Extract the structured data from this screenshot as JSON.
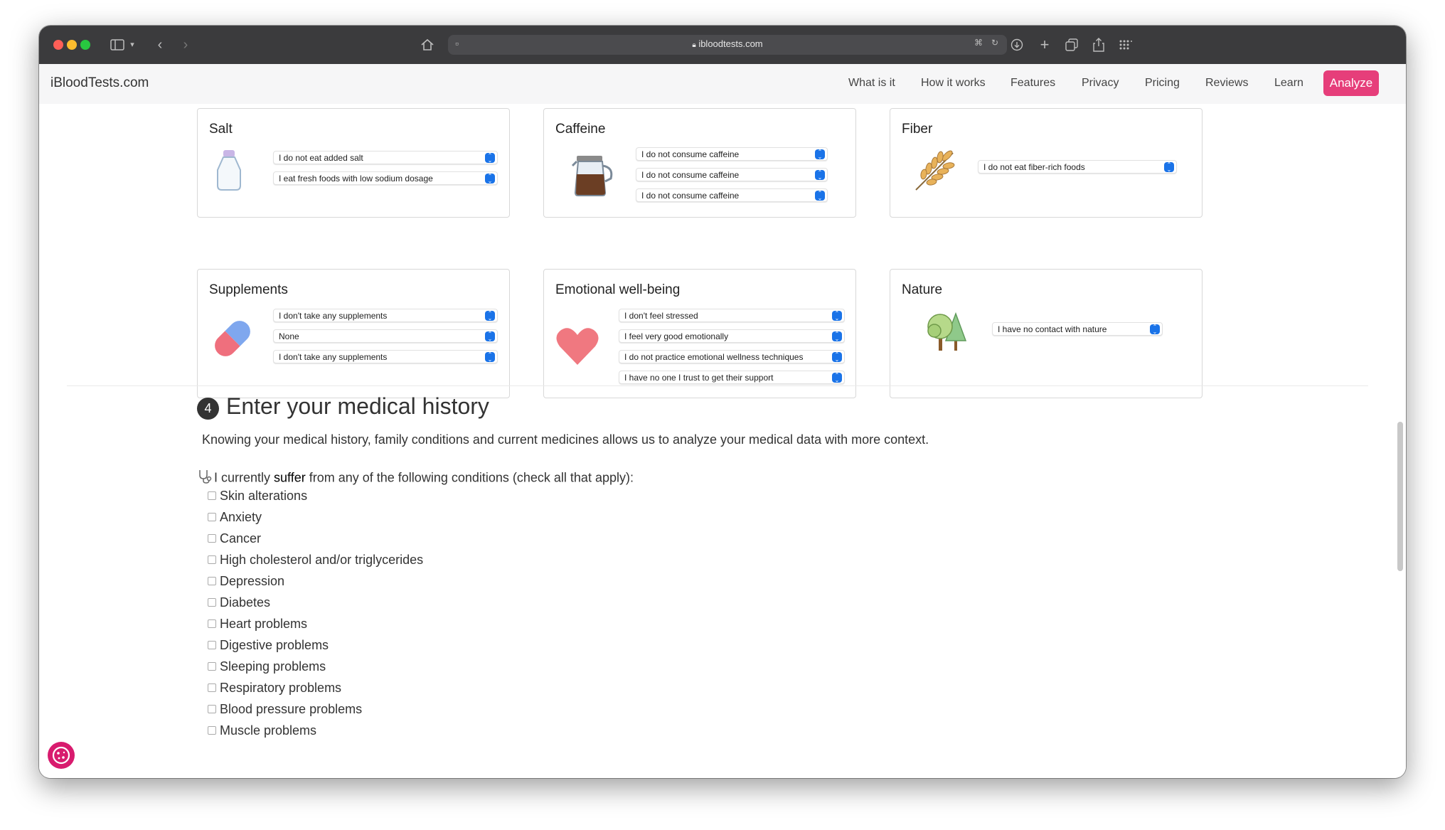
{
  "browser": {
    "url": "ibloodtests.com"
  },
  "nav": {
    "brand": "iBloodTests.com",
    "links": [
      "What is it",
      "How it works",
      "Features",
      "Privacy",
      "Pricing",
      "Reviews",
      "Learn"
    ],
    "cta": "Analyze"
  },
  "cards": {
    "salt": {
      "title": "Salt",
      "selects": [
        "I do not eat added salt",
        "I eat fresh foods with low sodium dosage"
      ]
    },
    "caffeine": {
      "title": "Caffeine",
      "selects": [
        "I do not consume caffeine",
        "I do not consume caffeine",
        "I do not consume caffeine"
      ]
    },
    "fiber": {
      "title": "Fiber",
      "selects": [
        "I do not eat fiber-rich foods"
      ]
    },
    "supplements": {
      "title": "Supplements",
      "selects": [
        "I don't take any supplements",
        "None",
        "I don't take any supplements"
      ]
    },
    "emotional": {
      "title": "Emotional well-being",
      "selects": [
        "I don't feel stressed",
        "I feel very good emotionally",
        "I do not practice emotional wellness techniques",
        "I have no one I trust to get their support"
      ]
    },
    "nature": {
      "title": "Nature",
      "selects": [
        "I have no contact with nature"
      ]
    }
  },
  "section4": {
    "number": "4",
    "title": "Enter your medical history",
    "description": "Knowing your medical history, family conditions and current medicines allows us to analyze your medical data with more context.",
    "question_pre": "I currently ",
    "question_bold": "suffer",
    "question_post": " from any of the following conditions (check all that apply):",
    "conditions": [
      "Skin alterations",
      "Anxiety",
      "Cancer",
      "High cholesterol and/or triglycerides",
      "Depression",
      "Diabetes",
      "Heart problems",
      "Digestive problems",
      "Sleeping problems",
      "Respiratory problems",
      "Blood pressure problems",
      "Muscle problems"
    ]
  },
  "colors": {
    "accent": "#e63e7a",
    "select_arrow": "#1a73e8"
  }
}
